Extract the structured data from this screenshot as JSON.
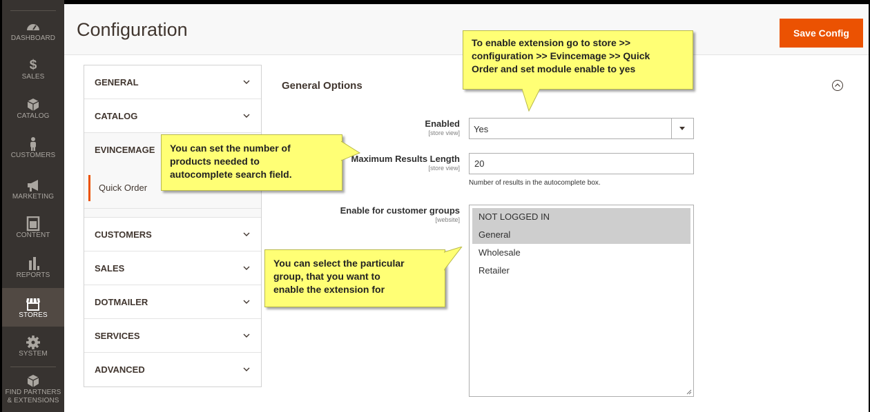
{
  "sidebar": {
    "items": [
      {
        "label": "Dashboard",
        "icon": "dashboard-icon"
      },
      {
        "label": "Sales",
        "icon": "dollar-icon"
      },
      {
        "label": "Catalog",
        "icon": "cube-icon"
      },
      {
        "label": "Customers",
        "icon": "person-icon"
      },
      {
        "label": "Marketing",
        "icon": "megaphone-icon"
      },
      {
        "label": "Content",
        "icon": "content-icon"
      },
      {
        "label": "Reports",
        "icon": "bar-chart-icon"
      },
      {
        "label": "Stores",
        "icon": "store-icon"
      },
      {
        "label": "System",
        "icon": "gear-icon"
      },
      {
        "label": "Find Partners",
        "label2": "& Extensions",
        "icon": "box-icon"
      }
    ],
    "active": "Stores"
  },
  "header": {
    "title": "Configuration",
    "save_label": "Save Config"
  },
  "nav": {
    "general": "GENERAL",
    "catalog": "CATALOG",
    "evincemage": "EVINCEMAGE",
    "quick_order": "Quick Order",
    "customers": "CUSTOMERS",
    "sales": "SALES",
    "dotmailer": "DOTMAILER",
    "services": "SERVICES",
    "advanced": "ADVANCED"
  },
  "section": {
    "title": "General Options",
    "enabled": {
      "label": "Enabled",
      "scope": "[store view]",
      "value": "Yes"
    },
    "max_results": {
      "label": "Maximum Results Length",
      "scope": "[store view]",
      "value": "20",
      "note": "Number of results in the autocomplete box."
    },
    "groups": {
      "label": "Enable for customer groups",
      "scope": "[website]",
      "options": [
        "NOT LOGGED IN",
        "General",
        "Wholesale",
        "Retailer"
      ],
      "selected": [
        "NOT LOGGED IN",
        "General"
      ]
    }
  },
  "callouts": {
    "top_line1": "To enable extension go to store >>",
    "top_line2": "configuration >> Evincemage >> Quick",
    "top_line3": "Order and set module enable to yes",
    "left_line1": "You can set the number of",
    "left_line2": "products needed to",
    "left_line3": "autocomplete search field.",
    "mid_line1": "You can select the particular",
    "mid_line2": "group, that you want to",
    "mid_line3": "enable the extension for"
  },
  "colors": {
    "accent": "#eb5202",
    "sidebar_bg": "#373330",
    "callout_bg": "#ffff75"
  }
}
